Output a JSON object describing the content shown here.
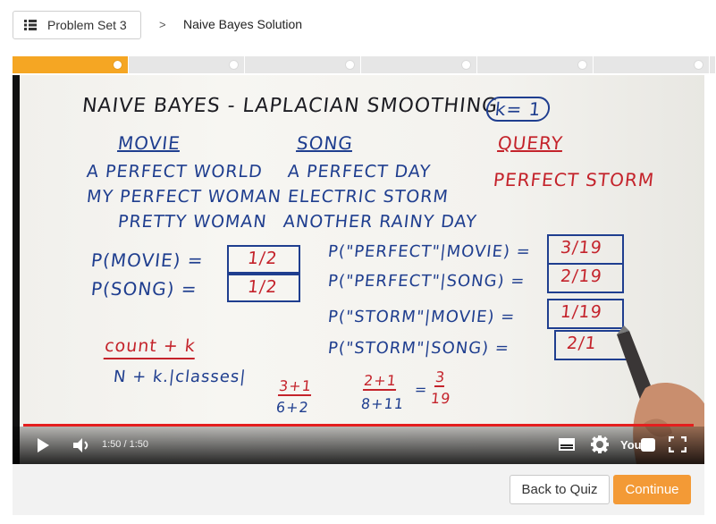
{
  "header": {
    "menu_label": "Problem Set 3",
    "separator": ">",
    "title": "Naive Bayes Solution"
  },
  "progress": {
    "segments": 6,
    "completed": 1
  },
  "video": {
    "board": {
      "heading": "NAIVE BAYES - LAPLACIAN SMOOTHING",
      "k_label": "k= 1",
      "col_movie": "MOVIE",
      "col_song": "SONG",
      "col_query": "QUERY",
      "movie_1": "A PERFECT WORLD",
      "movie_2": "MY PERFECT WOMAN",
      "movie_3": "PRETTY WOMAN",
      "song_1": "A PERFECT DAY",
      "song_2": "ELECTRIC STORM",
      "song_3": "ANOTHER RAINY DAY",
      "query_1": "PERFECT STORM",
      "p_movie": "P(MOVIE) =",
      "p_movie_val": "1/2",
      "p_song": "P(SONG) =",
      "p_song_val": "1/2",
      "p1": "P(\"PERFECT\"|MOVIE) =",
      "p1_val": "3/19",
      "p2": "P(\"PERFECT\"|SONG) =",
      "p2_val": "2/19",
      "p3": "P(\"STORM\"|MOVIE) =",
      "p3_val": "1/19",
      "p4": "P(\"STORM\"|SONG) =",
      "p4_val": "2/1",
      "formula_num": "count + k",
      "formula_den": "N + k.|classes|",
      "calc1_num": "3+1",
      "calc1_den": "6+2",
      "calc2_num": "2+1",
      "calc2_den": "8+11",
      "calc2_eq": "=",
      "calc2_res_num": "3",
      "calc2_res_den": "19"
    },
    "time": "1:50 / 1:50",
    "progress_fraction": 1.0
  },
  "footer": {
    "back_label": "Back to Quiz",
    "continue_label": "Continue"
  },
  "colors": {
    "accent": "#f39a36",
    "progress_active": "#f5a623",
    "scrubber": "#e41e1e"
  }
}
